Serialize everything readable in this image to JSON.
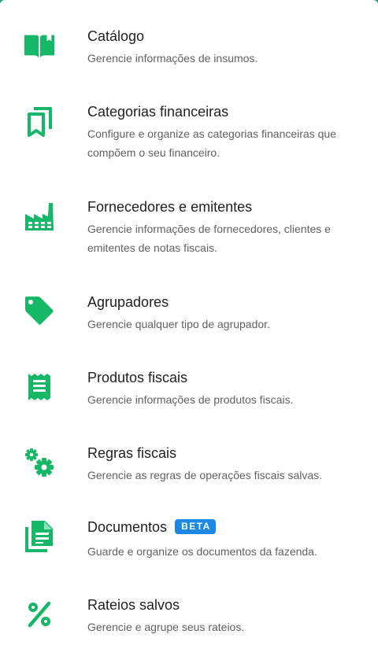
{
  "colors": {
    "icon_green": "#14b866",
    "beta_blue": "#1e88e5",
    "title_text": "#212121",
    "desc_text": "#616161"
  },
  "items": [
    {
      "icon": "book-open-icon",
      "title": "Catálogo",
      "description": "Gerencie informações de insumos."
    },
    {
      "icon": "bookmarks-icon",
      "title": "Categorias financeiras",
      "description": "Configure e organize as categorias financeiras que compõem o seu financeiro."
    },
    {
      "icon": "factory-icon",
      "title": "Fornecedores e emitentes",
      "description": "Gerencie informações de fornecedores, clientes e emitentes de notas fiscais."
    },
    {
      "icon": "tag-icon",
      "title": "Agrupadores",
      "description": "Gerencie qualquer tipo de agrupador."
    },
    {
      "icon": "receipt-icon",
      "title": "Produtos fiscais",
      "description": "Gerencie informações de produtos fiscais."
    },
    {
      "icon": "gears-icon",
      "title": "Regras fiscais",
      "description": "Gerencie as regras de operações fiscais salvas."
    },
    {
      "icon": "documents-icon",
      "title": "Documentos",
      "badge": "BETA",
      "description": "Guarde e organize os documentos da fazenda."
    },
    {
      "icon": "percent-icon",
      "title": "Rateios salvos",
      "description": "Gerencie e agrupe seus rateios."
    }
  ]
}
